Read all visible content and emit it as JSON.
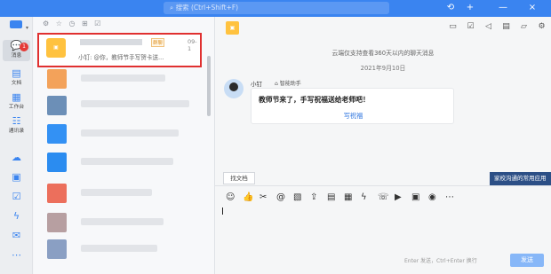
{
  "app": {
    "search_placeholder": "搜索 (Ctrl+Shift+F)",
    "top_icons": [
      "history-icon",
      "plus-icon",
      "minimize-icon",
      "close-icon"
    ]
  },
  "rail": {
    "badge_count": "1",
    "items": [
      {
        "label": "消息",
        "icon": "chat-icon"
      },
      {
        "label": "文档",
        "icon": "doc-icon"
      },
      {
        "label": "工作台",
        "icon": "apps-icon"
      },
      {
        "label": "通讯录",
        "icon": "contacts-icon"
      }
    ]
  },
  "conversation": {
    "tag": "群聊",
    "time": "09-1",
    "preview": "小钉: @你，教师节手写贺卡送..."
  },
  "chat": {
    "system_notice": "云端仅支持查看360天以内的聊天消息",
    "date": "2021年9月10日",
    "sender": "小钉",
    "assistant": "智能助手",
    "message": "教师节来了，手写祝福送给老师吧！",
    "action_link": "写祝福",
    "doc_button": "找文档",
    "tooltip": "家校沟通的常用应用",
    "hint": "Enter 发送，Ctrl+Enter 换行",
    "send_label": "发送"
  }
}
